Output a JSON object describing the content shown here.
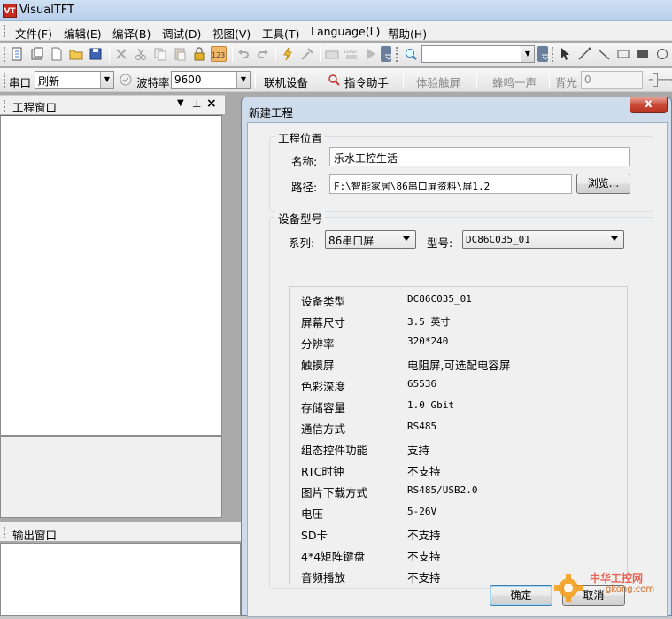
{
  "window": {
    "title": "VisualTFT",
    "icon_text": "VT"
  },
  "menu": [
    "文件(F)",
    "编辑(E)",
    "编译(B)",
    "调试(D)",
    "视图(V)",
    "工具(T)",
    "Language(L)",
    "帮助(H)"
  ],
  "toolbar2": {
    "port_label": "串口",
    "port_value": "刷新",
    "baud_label": "波特率",
    "baud_value": "9600",
    "online_device": "联机设备",
    "command_helper": "指令助手",
    "touch_experience": "体验触屏",
    "buzzer": "蜂鸣一声",
    "backlight_label": "背光",
    "backlight_value": "0"
  },
  "panels": {
    "project_window": "工程窗口",
    "output_window": "输出窗口"
  },
  "dialog": {
    "title": "新建工程",
    "close_label": "x",
    "location_group": "工程位置",
    "name_label": "名称:",
    "name_value": "乐水工控生活",
    "path_label": "路径:",
    "path_value": "F:\\智能家居\\86串口屏资料\\屏1.2",
    "browse_label": "浏览...",
    "device_group": "设备型号",
    "series_label": "系列:",
    "series_value": "86串口屏",
    "model_label": "型号:",
    "model_value": "DC86C035_01",
    "specs": [
      {
        "k": "设备类型",
        "v": "DC86C035_01"
      },
      {
        "k": "屏幕尺寸",
        "v": "3.5 英寸"
      },
      {
        "k": "分辨率",
        "v": "320*240"
      },
      {
        "k": "触摸屏",
        "v": "电阻屏,可选配电容屏"
      },
      {
        "k": "色彩深度",
        "v": "65536"
      },
      {
        "k": "存储容量",
        "v": "1.0 Gbit"
      },
      {
        "k": "通信方式",
        "v": "RS485"
      },
      {
        "k": "组态控件功能",
        "v": "支持"
      },
      {
        "k": "RTC时钟",
        "v": "不支持"
      },
      {
        "k": "图片下载方式",
        "v": "RS485/USB2.0"
      },
      {
        "k": "电压",
        "v": "5-26V"
      },
      {
        "k": "SD卡",
        "v": "不支持"
      },
      {
        "k": "4*4矩阵键盘",
        "v": "不支持"
      },
      {
        "k": "音频播放",
        "v": "不支持"
      }
    ],
    "ok_label": "确定",
    "cancel_label": "取消"
  },
  "watermark": {
    "line1": "中华工控网",
    "line2": "gkong.com"
  }
}
